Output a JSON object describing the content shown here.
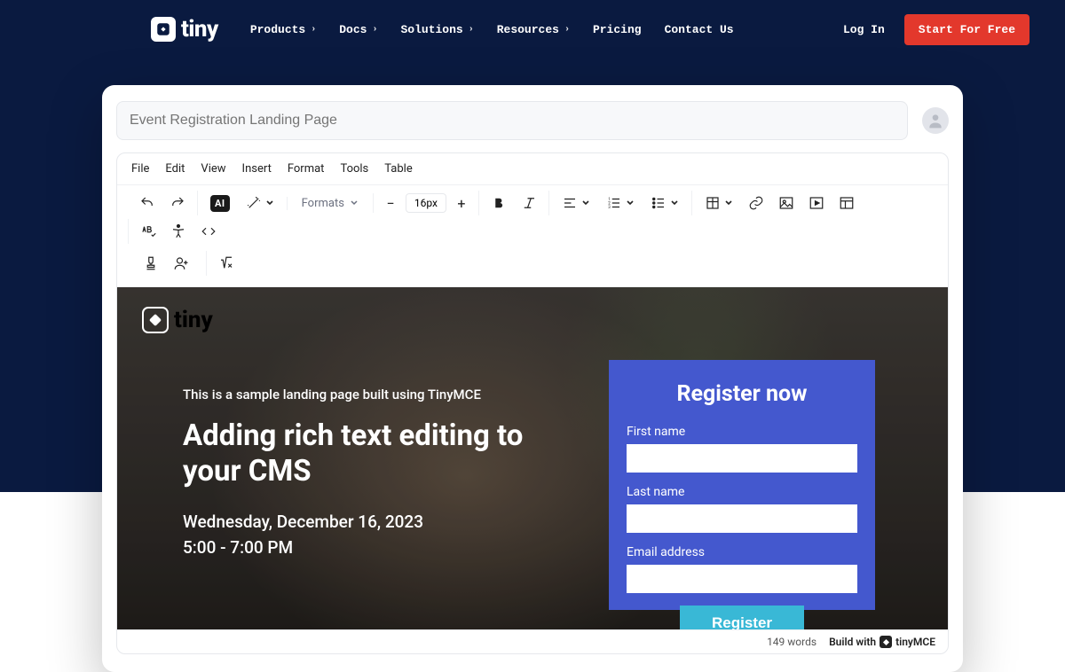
{
  "header": {
    "logo_text": "tiny",
    "nav": [
      "Products",
      "Docs",
      "Solutions",
      "Resources",
      "Pricing",
      "Contact Us"
    ],
    "nav_has_chevron": [
      true,
      true,
      true,
      true,
      false,
      false
    ],
    "login": "Log In",
    "cta": "Start For Free"
  },
  "editor": {
    "title_placeholder": "Event Registration Landing Page",
    "menubar": [
      "File",
      "Edit",
      "View",
      "Insert",
      "Format",
      "Tools",
      "Table"
    ],
    "formats_label": "Formats",
    "fontsize": "16px",
    "ai_label": "AI"
  },
  "content": {
    "logo_text": "tiny",
    "tagline": "This is a sample landing page built using TinyMCE",
    "headline": "Adding rich text editing to your CMS",
    "date_line": "Wednesday, December 16, 2023",
    "time_line": "5:00 - 7:00 PM",
    "register": {
      "title": "Register now",
      "first_name_label": "First name",
      "last_name_label": "Last name",
      "email_label": "Email address",
      "button": "Register"
    }
  },
  "status": {
    "words": "149 words",
    "build_with": "Build with",
    "brand": "tinyMCE"
  }
}
